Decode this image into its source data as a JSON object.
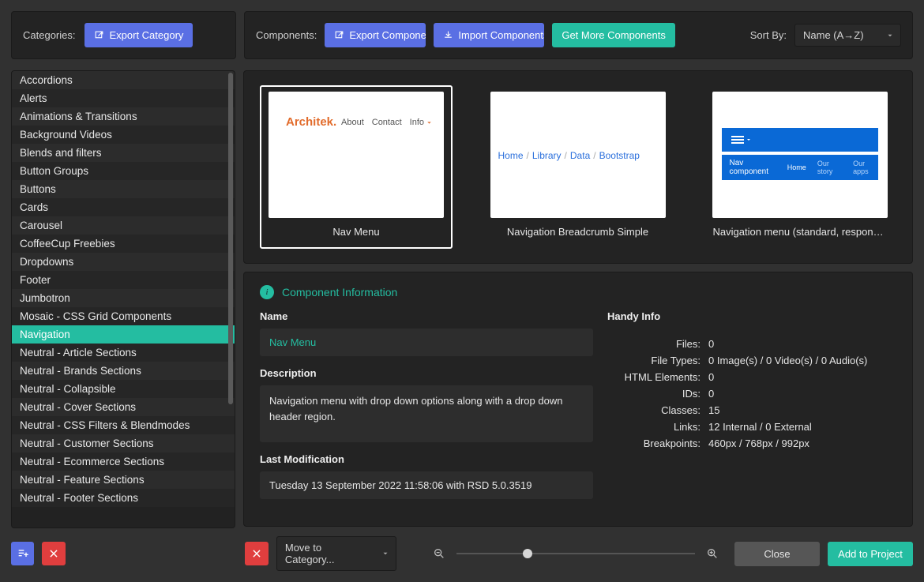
{
  "header": {
    "categories_label": "Categories:",
    "export_category": "Export Category",
    "components_label": "Components:",
    "export_component": "Export Component",
    "import_components": "Import Components",
    "get_more": "Get More Components",
    "sort_by_label": "Sort By:",
    "sort_value": "Name (A→Z)"
  },
  "categories": [
    "Accordions",
    "Alerts",
    "Animations & Transitions",
    "Background Videos",
    "Blends and filters",
    "Button Groups",
    "Buttons",
    "Cards",
    "Carousel",
    "CoffeeCup Freebies",
    "Dropdowns",
    "Footer",
    "Jumbotron",
    "Mosaic - CSS Grid Components",
    "Navigation",
    "Neutral - Article Sections",
    "Neutral - Brands Sections",
    "Neutral - Collapsible",
    "Neutral - Cover Sections",
    "Neutral - CSS Filters & Blendmodes",
    "Neutral - Customer Sections",
    "Neutral - Ecommerce Sections",
    "Neutral - Feature Sections",
    "Neutral - Footer Sections"
  ],
  "selected_category_index": 14,
  "gallery": {
    "items": [
      {
        "caption": "Nav Menu",
        "selected": true
      },
      {
        "caption": "Navigation Breadcrumb Simple",
        "selected": false
      },
      {
        "caption": "Navigation menu (standard, responsi…",
        "selected": false
      }
    ]
  },
  "thumbs": {
    "thumb1": {
      "brand": "Architek.",
      "items": [
        "About",
        "Contact",
        "Info"
      ]
    },
    "thumb2": {
      "crumbs": [
        "Home",
        "Library",
        "Data",
        "Bootstrap"
      ],
      "sep": "/"
    },
    "thumb3": {
      "title": "Nav component",
      "links": [
        "Home",
        "Our story",
        "Our apps"
      ]
    }
  },
  "info": {
    "section_title": "Component Information",
    "name_label": "Name",
    "name_value": "Nav Menu",
    "desc_label": "Description",
    "desc_value": "Navigation menu with drop down options along with a drop down header region.",
    "mod_label": "Last Modification",
    "mod_value": "Tuesday 13 September 2022 11:58:06 with RSD 5.0.3519",
    "handy_label": "Handy Info",
    "kv": [
      {
        "k": "Files:",
        "v": "0"
      },
      {
        "k": "File Types:",
        "v": "0 Image(s) / 0 Video(s) / 0 Audio(s)"
      },
      {
        "k": "HTML Elements:",
        "v": "0"
      },
      {
        "k": "IDs:",
        "v": "0"
      },
      {
        "k": "Classes:",
        "v": "15"
      },
      {
        "k": "Links:",
        "v": "12 Internal / 0 External"
      },
      {
        "k": "Breakpoints:",
        "v": "460px / 768px / 992px"
      }
    ]
  },
  "footer": {
    "move_to_category": "Move to Category...",
    "close": "Close",
    "add_to_project": "Add to Project"
  }
}
